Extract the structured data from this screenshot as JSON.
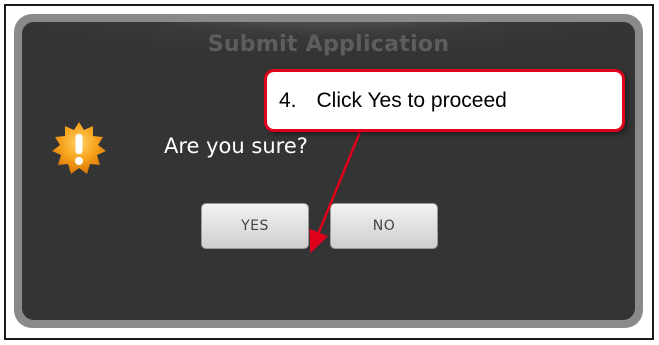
{
  "dialog": {
    "title": "Submit Application",
    "message": "Are you sure?",
    "icon": "warning-icon",
    "buttons": {
      "yes_label": "YES",
      "no_label": "NO"
    }
  },
  "callout": {
    "number": "4.",
    "text": "Click Yes to proceed",
    "border_color": "#e0001b",
    "arrow_color": "#e0001b"
  },
  "colors": {
    "dialog_bg": "#343434",
    "dialog_border": "#8a8a8a",
    "icon_orange": "#f7a21b"
  }
}
